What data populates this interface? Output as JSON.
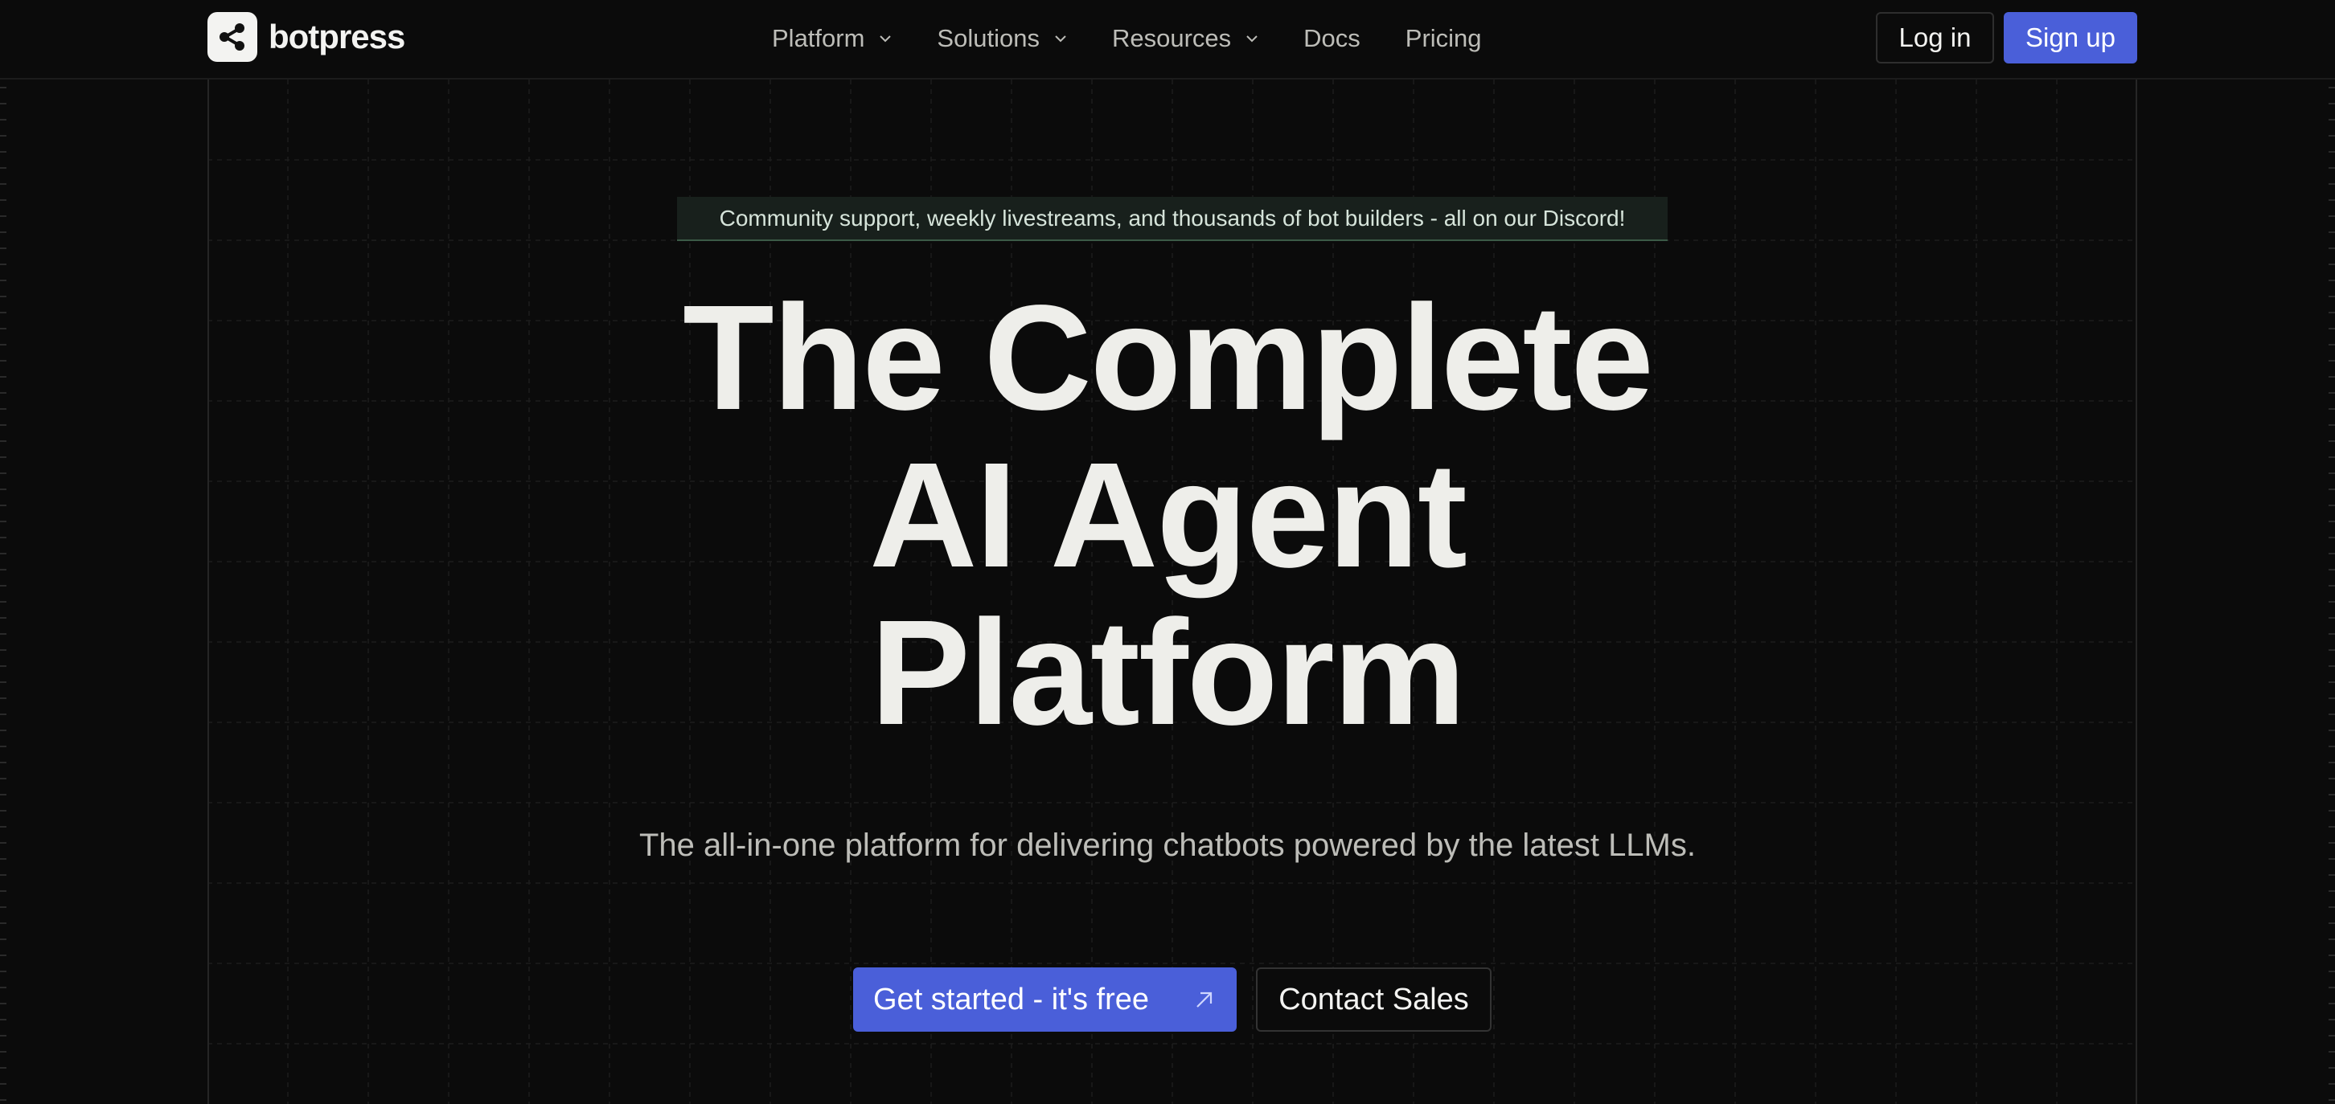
{
  "brand": {
    "name": "botpress",
    "logo_icon": "share-nodes-icon"
  },
  "nav": {
    "items": [
      {
        "label": "Platform",
        "has_dropdown": true
      },
      {
        "label": "Solutions",
        "has_dropdown": true
      },
      {
        "label": "Resources",
        "has_dropdown": true
      },
      {
        "label": "Docs",
        "has_dropdown": false
      },
      {
        "label": "Pricing",
        "has_dropdown": false
      }
    ],
    "login_label": "Log in",
    "signup_label": "Sign up"
  },
  "hero": {
    "announcement": "Community support, weekly livestreams, and thousands of bot builders - all on our Discord!",
    "title_lines": [
      "The Complete",
      "AI Agent",
      "Platform"
    ],
    "subtitle": "The all-in-one platform for delivering chatbots powered by the latest LLMs.",
    "cta_primary": "Get started - it's free",
    "cta_primary_icon": "arrow-up-right-icon",
    "cta_secondary": "Contact Sales"
  },
  "colors": {
    "background": "#0b0b0b",
    "accent": "#4a5fd9",
    "text_primary": "#eeeeea",
    "text_muted": "#bdbdb8",
    "announcement_bg": "#18201c",
    "announcement_border": "#3b5a47"
  }
}
